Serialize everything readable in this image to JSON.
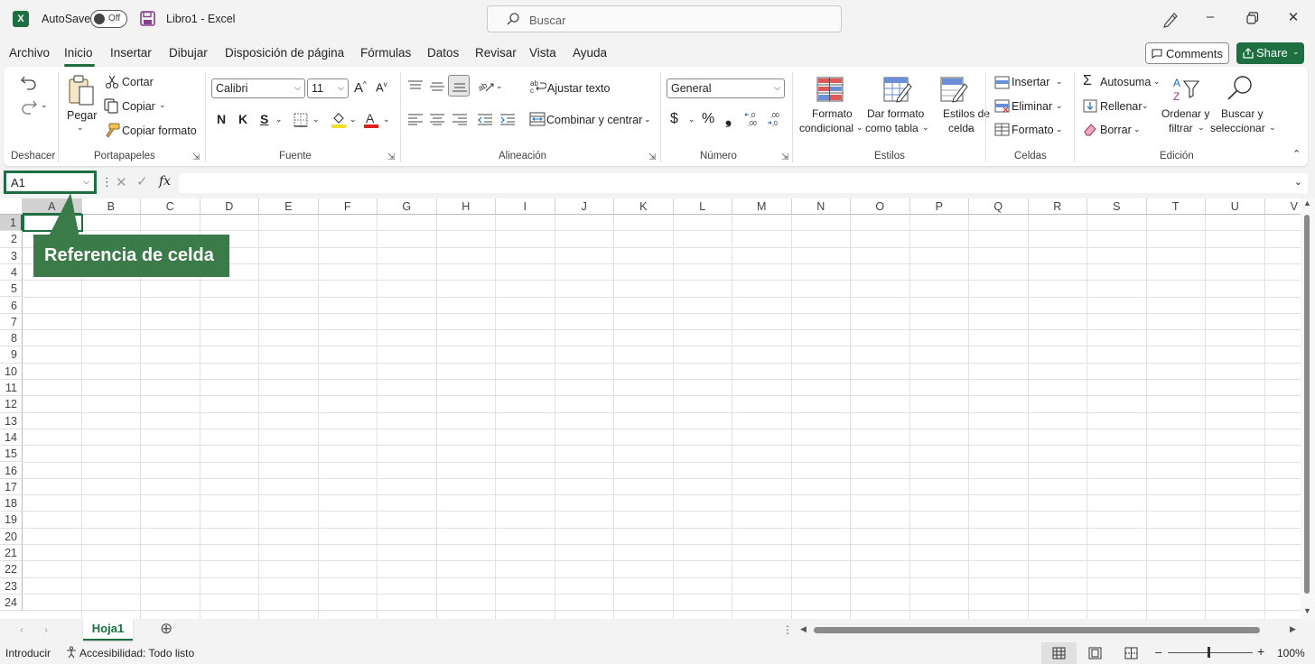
{
  "titlebar": {
    "app_logo": "X",
    "autosave_label": "AutoSave",
    "autosave_state": "Off",
    "document_title": "Libro1  -  Excel",
    "search_placeholder": "Buscar"
  },
  "menu": {
    "items": [
      "Archivo",
      "Inicio",
      "Insertar",
      "Dibujar",
      "Disposición de página",
      "Fórmulas",
      "Datos",
      "Revisar",
      "Vista",
      "Ayuda"
    ],
    "active": "Inicio",
    "comments_label": "Comments",
    "share_label": "Share"
  },
  "ribbon": {
    "undo_group": "Deshacer",
    "clipboard": {
      "group": "Portapapeles",
      "paste": "Pegar",
      "cut": "Cortar",
      "copy": "Copiar",
      "format_painter": "Copiar formato"
    },
    "font": {
      "group": "Fuente",
      "font_name": "Calibri",
      "font_size": "11",
      "bold": "N",
      "italic": "K",
      "underline": "S"
    },
    "alignment": {
      "group": "Alineación",
      "wrap_text": "Ajustar texto",
      "merge_center": "Combinar y centrar"
    },
    "number": {
      "group": "Número",
      "format": "General",
      "currency": "$",
      "percent": "%",
      "comma": "❟",
      "inc_decimal": "←,0 ,00",
      "dec_decimal": ",00 →,0"
    },
    "styles": {
      "group": "Estilos",
      "conditional_1": "Formato",
      "conditional_2": "condicional",
      "as_table_1": "Dar formato",
      "as_table_2": "como tabla",
      "cell_styles_1": "Estilos de",
      "cell_styles_2": "celda"
    },
    "cells": {
      "group": "Celdas",
      "insert": "Insertar",
      "delete": "Eliminar",
      "format": "Formato"
    },
    "editing": {
      "group": "Edición",
      "autosum": "Autosuma",
      "fill": "Rellenar",
      "clear": "Borrar",
      "sort_1": "Ordenar y",
      "sort_2": "filtrar",
      "find_1": "Buscar y",
      "find_2": "seleccionar"
    }
  },
  "formula_bar": {
    "name_box": "A1",
    "fx": "fx",
    "value": ""
  },
  "grid": {
    "columns": [
      "A",
      "B",
      "C",
      "D",
      "E",
      "F",
      "G",
      "H",
      "I",
      "J",
      "K",
      "L",
      "M",
      "N",
      "O",
      "P",
      "Q",
      "R",
      "S",
      "T",
      "U",
      "V"
    ],
    "rows": [
      "1",
      "2",
      "3",
      "4",
      "5",
      "6",
      "7",
      "8",
      "9",
      "10",
      "11",
      "12",
      "13",
      "14",
      "15",
      "16",
      "17",
      "18",
      "19",
      "20",
      "21",
      "22",
      "23",
      "24"
    ],
    "selected_cell": "A1"
  },
  "callout": {
    "text": "Referencia de celda"
  },
  "sheets": {
    "tabs": [
      "Hoja1"
    ],
    "active": "Hoja1"
  },
  "status": {
    "mode": "Introducir",
    "accessibility": "Accesibilidad: Todo listo",
    "zoom": "100%"
  },
  "colors": {
    "excel_green": "#1d6f42",
    "callout_green": "#3b7a49"
  }
}
